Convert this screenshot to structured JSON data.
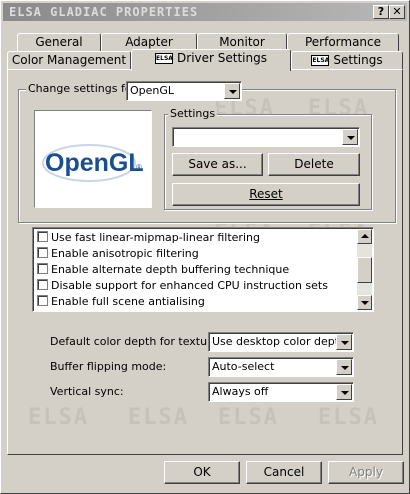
{
  "window": {
    "title": "ELSA GLADIAC PROPERTIES",
    "help_label": "?",
    "close_label": "✕"
  },
  "tabs_back": [
    "General",
    "Adapter",
    "Monitor",
    "Performance"
  ],
  "tabs_front": [
    {
      "label": "Color Management",
      "logo": false
    },
    {
      "label": "Driver Settings",
      "logo": true,
      "active": true
    },
    {
      "label": "Settings",
      "logo": true
    }
  ],
  "tab_logo_text": "ELSA",
  "watermark_text": "ELSA",
  "change_settings": {
    "label": "Change settings for",
    "value": "OpenGL"
  },
  "logo": {
    "text": "OpenGL",
    "mark": "®",
    "color": "#1a4f8f"
  },
  "settings_group": {
    "label": "Settings",
    "combo_value": "",
    "save_as": "Save as...",
    "delete": "Delete",
    "reset": "Reset"
  },
  "options": [
    {
      "label": "Use fast linear-mipmap-linear filtering",
      "checked": false
    },
    {
      "label": "Enable anisotropic filtering",
      "checked": false
    },
    {
      "label": "Enable alternate depth buffering technique",
      "checked": false
    },
    {
      "label": "Disable support for enhanced CPU instruction sets",
      "checked": false
    },
    {
      "label": "Enable full scene antialising",
      "checked": false
    }
  ],
  "fields": [
    {
      "label": "Default color depth for textures:",
      "value": "Use desktop color depth"
    },
    {
      "label": "Buffer flipping mode:",
      "value": "Auto-select"
    },
    {
      "label": "Vertical sync:",
      "value": "Always off"
    }
  ],
  "footer": {
    "ok": "OK",
    "cancel": "Cancel",
    "apply": "Apply"
  }
}
